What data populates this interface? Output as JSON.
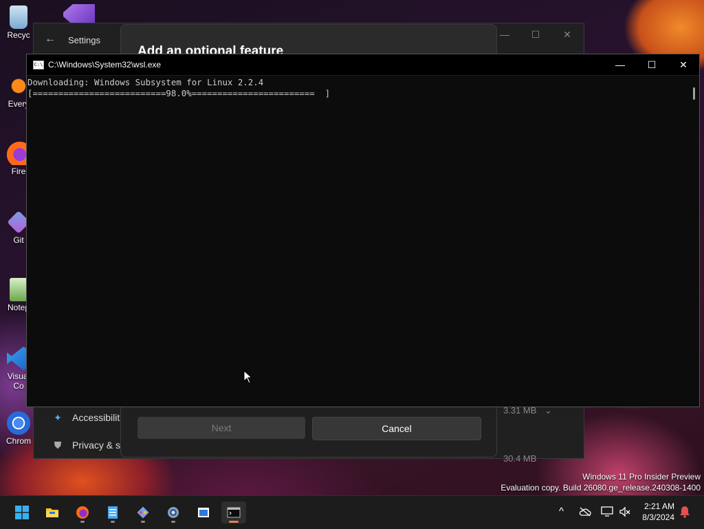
{
  "desktop": {
    "icons": [
      {
        "label": "Recyc",
        "icon": "recycle-bin-icon"
      },
      {
        "label": "Every",
        "icon": "everything-icon"
      },
      {
        "label": "Fire",
        "icon": "firefox-icon"
      },
      {
        "label": "Git",
        "icon": "git-icon"
      },
      {
        "label": "Notep",
        "icon": "notepad-icon"
      },
      {
        "label": "Visual",
        "label2": "Co",
        "icon": "vscode-icon"
      },
      {
        "label": "Chrom",
        "icon": "chrome-icon"
      }
    ],
    "watermark": {
      "line1": "Windows 11 Pro Insider Preview",
      "line2": "Evaluation copy. Build 26080.ge_release.240308-1400"
    }
  },
  "settings": {
    "back": "←",
    "title": "Settings",
    "minimize": "—",
    "maximize": "☐",
    "close": "✕",
    "dialog": {
      "title": "Add an optional feature",
      "next_label": "Next",
      "cancel_label": "Cancel"
    },
    "nav": [
      {
        "label": "Accessibilit",
        "icon": "accessibility-icon"
      },
      {
        "label": "Privacy & s",
        "icon": "shield-icon"
      }
    ],
    "sizes": [
      "3.31 MB",
      "30.4 MB"
    ]
  },
  "console": {
    "title": "C:\\Windows\\System32\\wsl.exe",
    "app_icon_text": "C:\\",
    "minimize": "—",
    "maximize": "☐",
    "close": "✕",
    "lines": [
      "Downloading: Windows Subsystem for Linux 2.2.4",
      "[==========================98.0%========================  ]"
    ],
    "progress_percent": 98.0
  },
  "taskbar": {
    "apps": [
      {
        "name": "start",
        "icon": "windows-start-icon"
      },
      {
        "name": "file-explorer",
        "icon": "folder-icon"
      },
      {
        "name": "firefox",
        "icon": "firefox-icon"
      },
      {
        "name": "notepad",
        "icon": "notepad-icon"
      },
      {
        "name": "git-gui",
        "icon": "git-icon"
      },
      {
        "name": "settings",
        "icon": "gear-icon"
      },
      {
        "name": "store",
        "icon": "store-icon"
      },
      {
        "name": "terminal",
        "icon": "terminal-icon",
        "active": true
      }
    ],
    "tray": {
      "chevron": "^",
      "time": "2:21 AM",
      "date": "8/3/2024"
    },
    "colors": {
      "accent": "#e08050",
      "notification": "#e05050"
    }
  }
}
